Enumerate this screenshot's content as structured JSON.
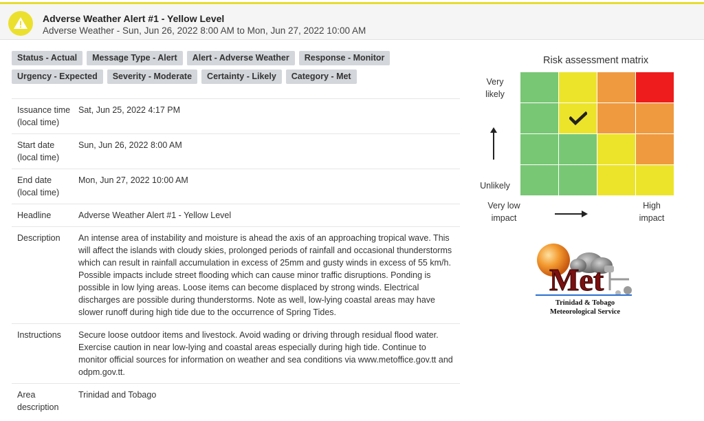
{
  "header": {
    "title": "Adverse Weather Alert #1 - Yellow Level",
    "subtitle": "Adverse Weather - Sun, Jun 26, 2022 8:00 AM to Mon, Jun 27, 2022 10:00 AM",
    "icon": "warning-icon",
    "accent_color": "#ece02e"
  },
  "tags": [
    [
      "Status - Actual",
      "Message Type - Alert",
      "Alert - Adverse Weather",
      "Response - Monitor"
    ],
    [
      "Urgency - Expected",
      "Severity - Moderate",
      "Certainty - Likely",
      "Category - Met"
    ]
  ],
  "details": [
    {
      "label": "Issuance time (local time)",
      "value": "Sat, Jun 25, 2022 4:17 PM"
    },
    {
      "label": "Start date (local time)",
      "value": "Sun, Jun 26, 2022 8:00 AM"
    },
    {
      "label": "End date (local time)",
      "value": "Mon, Jun 27, 2022 10:00 AM"
    },
    {
      "label": "Headline",
      "value": "Adverse Weather Alert #1 - Yellow Level"
    },
    {
      "label": "Description",
      "value": "An intense area of instability and moisture is ahead the axis of an approaching tropical wave. This will affect the islands with cloudy skies, prolonged periods of rainfall and occasional thunderstorms which can result in rainfall accumulation in excess of 25mm and gusty winds in excess of 55 km/h. Possible impacts include street flooding which can cause minor traffic disruptions. Ponding is possible in low lying areas. Loose items can become displaced by strong winds. Electrical discharges are possible during thunderstorms. Note as well, low-lying coastal areas may have slower runoff during high tide due to the occurrence of Spring Tides."
    },
    {
      "label": "Instructions",
      "value": "Secure loose outdoor items and livestock. Avoid wading or driving through residual flood water. Exercise caution in near low-lying and coastal areas especially during high tide. Continue to monitor official sources for information on weather and sea conditions via www.metoffice.gov.tt and odpm.gov.tt."
    },
    {
      "label": "Area description",
      "value": "Trinidad and Tobago"
    }
  ],
  "risk_matrix": {
    "title": "Risk assessment matrix",
    "y_top_label": "Very likely",
    "y_bottom_label": "Unlikely",
    "x_left_label": "Very low impact",
    "x_right_label": "High impact",
    "colors": {
      "green": "#78c774",
      "yellow": "#ece42a",
      "orange": "#ef9a3f",
      "red": "#ee1c1c"
    },
    "cells": [
      [
        "green",
        "yellow",
        "orange",
        "red"
      ],
      [
        "green",
        "yellow",
        "orange",
        "orange"
      ],
      [
        "green",
        "green",
        "yellow",
        "orange"
      ],
      [
        "green",
        "green",
        "yellow",
        "yellow"
      ]
    ],
    "selected": {
      "row": 1,
      "col": 1
    },
    "check_icon": "checkmark-icon"
  },
  "logo": {
    "wordmark": "Met",
    "line1": "Trinidad & Tobago",
    "line2": "Meteorological Service"
  }
}
